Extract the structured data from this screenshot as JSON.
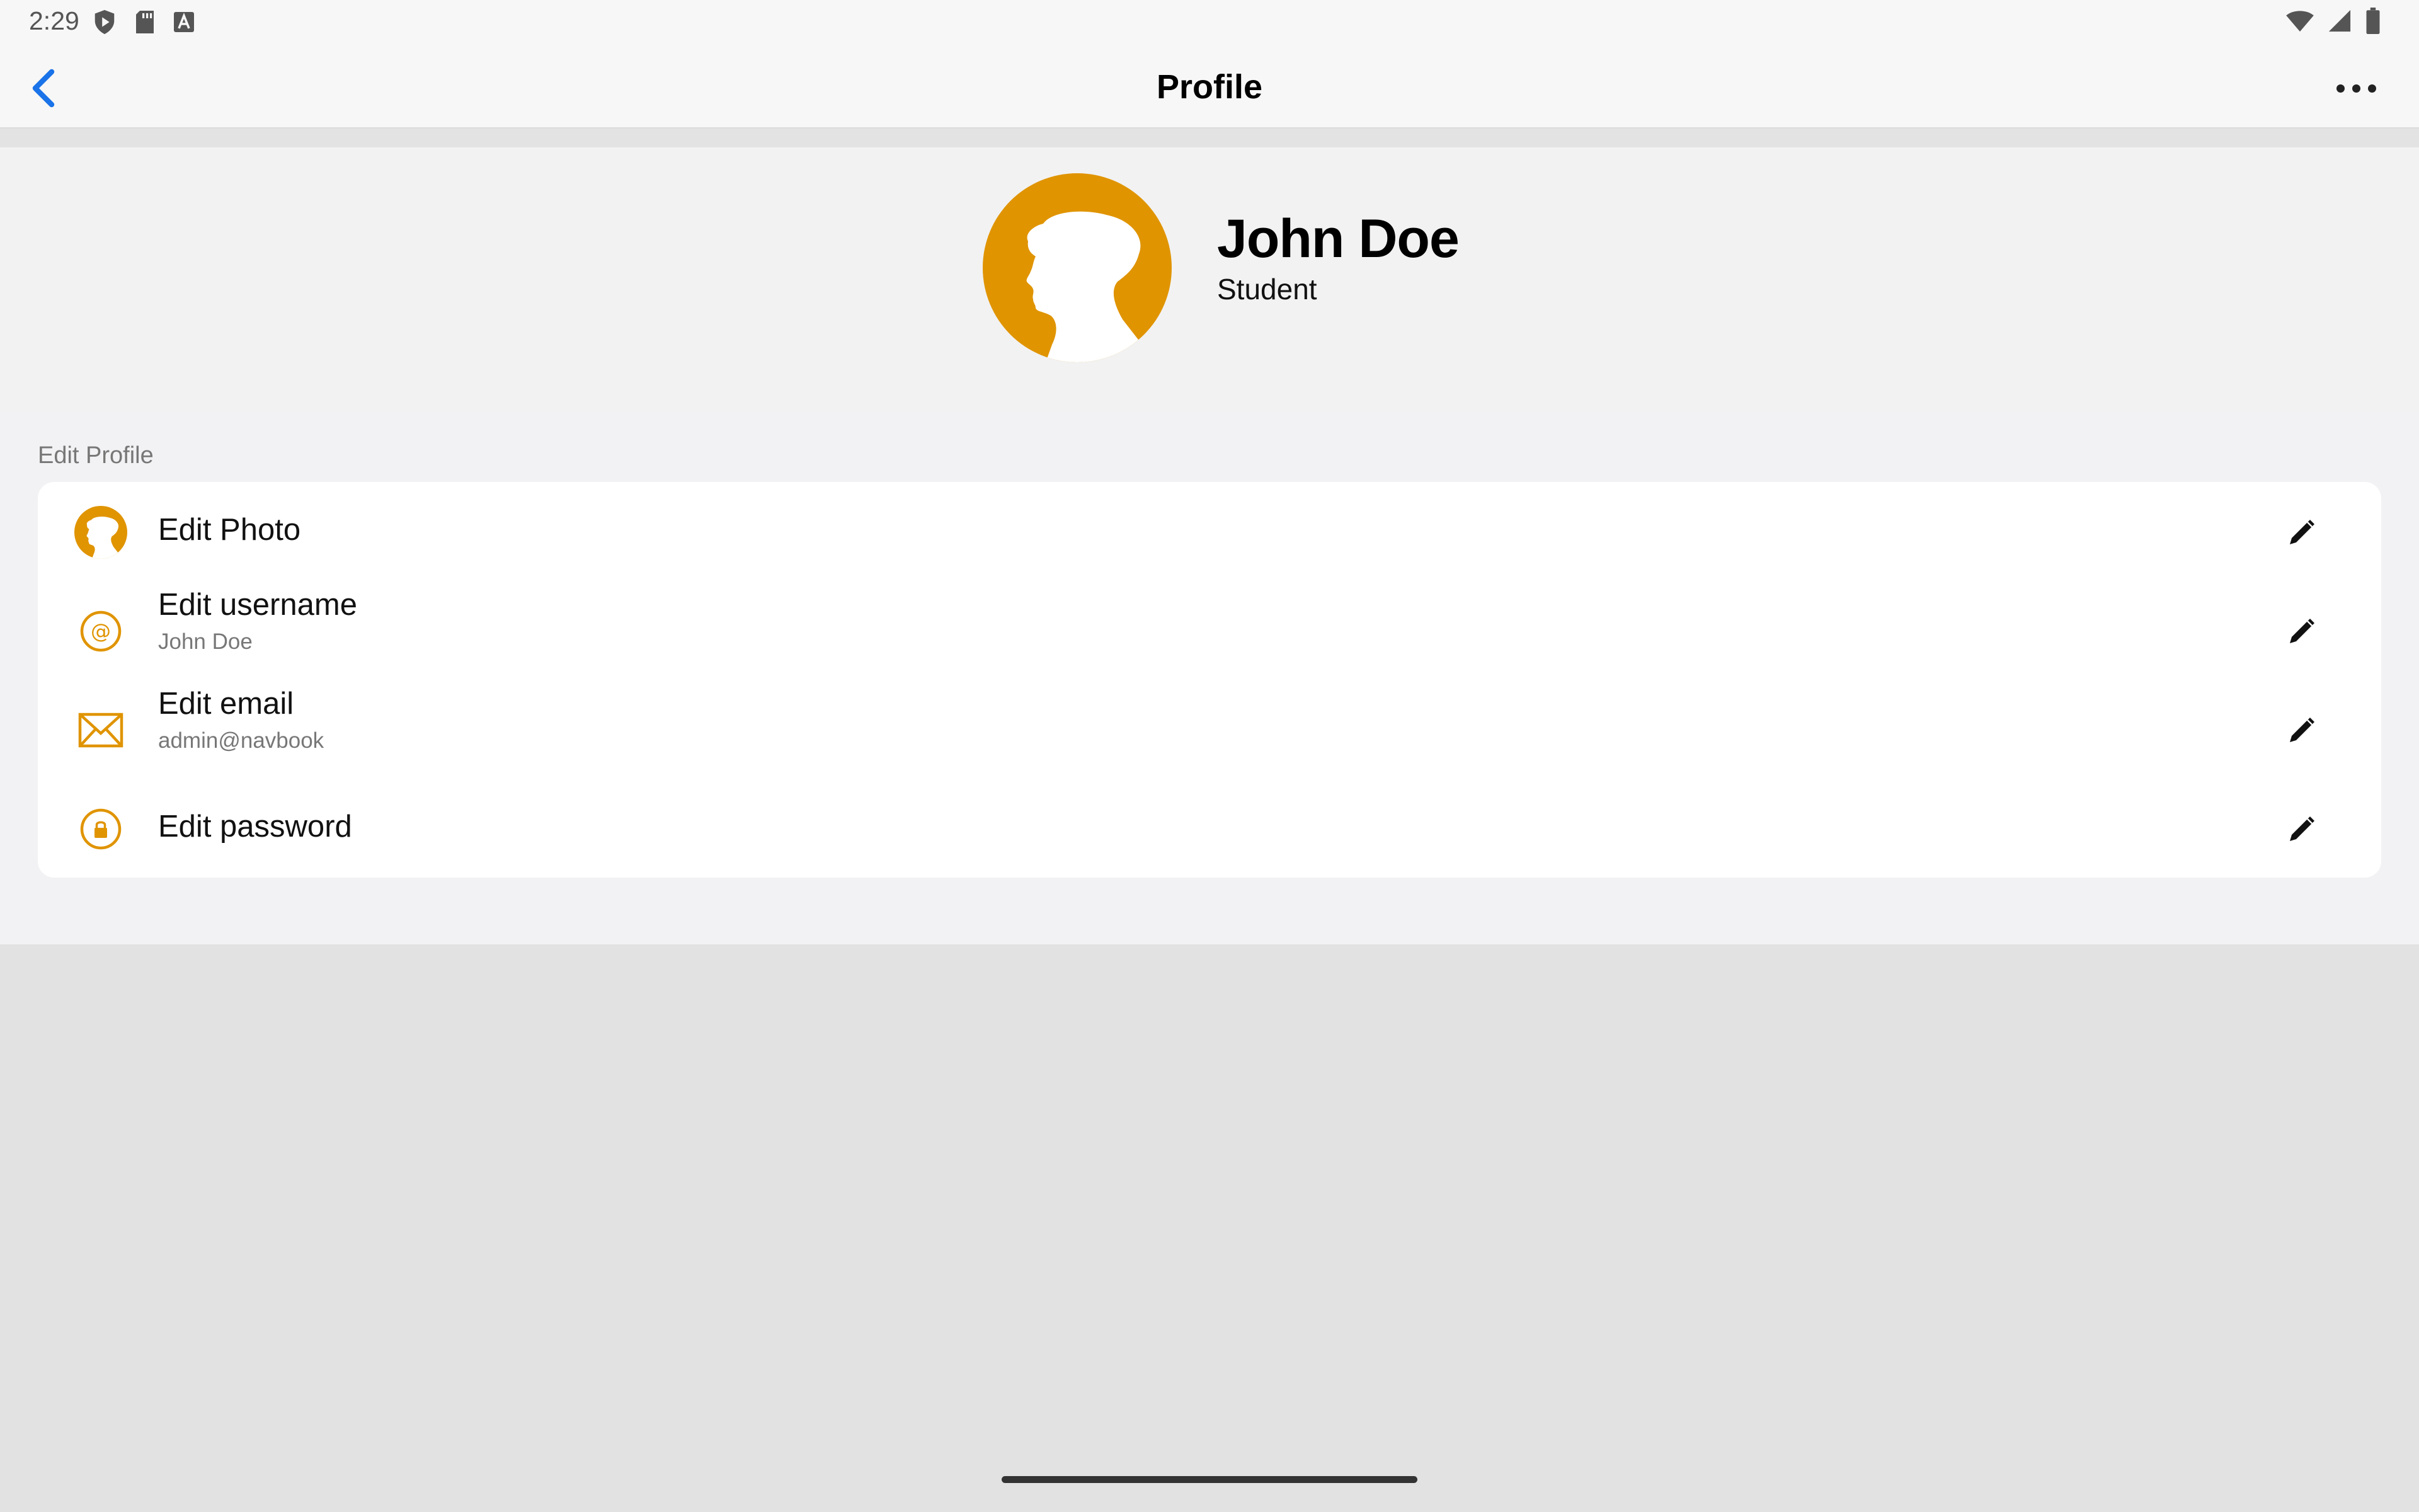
{
  "status_bar": {
    "time": "2:29",
    "left_icons": [
      "shield-play-icon",
      "sd-card-icon",
      "keyboard-a-icon"
    ],
    "right_icons": [
      "wifi-icon",
      "cell-signal-icon",
      "battery-icon"
    ]
  },
  "nav": {
    "title": "Profile",
    "back_icon": "chevron-left-icon",
    "more_icon": "more-horizontal-icon"
  },
  "profile": {
    "name": "John Doe",
    "role": "Student",
    "avatar_icon": "person-silhouette-icon"
  },
  "edit_section": {
    "label": "Edit Profile",
    "items": [
      {
        "title": "Edit Photo",
        "subtitle": "",
        "icon": "photo-avatar-icon",
        "action_icon": "pencil-icon"
      },
      {
        "title": "Edit username",
        "subtitle": "John Doe",
        "icon": "at-sign-icon",
        "action_icon": "pencil-icon"
      },
      {
        "title": "Edit email",
        "subtitle": "admin@navbook",
        "icon": "envelope-icon",
        "action_icon": "pencil-icon"
      },
      {
        "title": "Edit password",
        "subtitle": "",
        "icon": "lock-icon",
        "action_icon": "pencil-icon"
      }
    ]
  },
  "colors": {
    "accent": "#e09400",
    "link": "#1a73e8",
    "card": "#ffffff",
    "background": "#e2e2e2"
  }
}
